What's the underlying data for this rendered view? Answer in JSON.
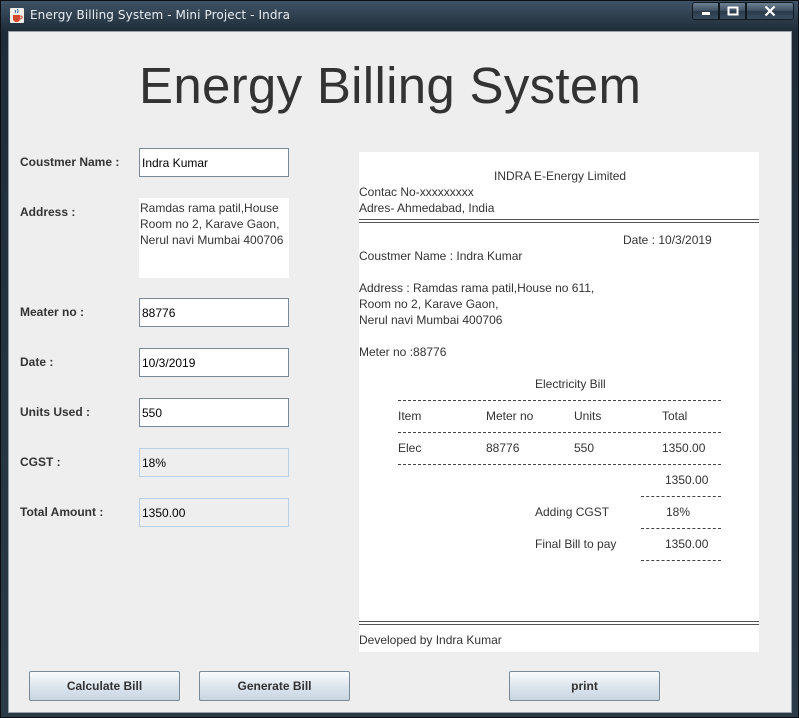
{
  "window": {
    "title": "Energy Billing System - Mini Project - Indra"
  },
  "heading": "Energy Billing System",
  "form": {
    "customer_name_label": "Coustmer Name :",
    "customer_name_value": "Indra Kumar",
    "address_label": "Address :",
    "address_lines": [
      "Ramdas rama patil,House",
      "Room no 2, Karave Gaon,",
      "Nerul navi Mumbai 400706"
    ],
    "meter_label": "Meater no :",
    "meter_value": "88776",
    "date_label": "Date :",
    "date_value": "10/3/2019",
    "units_label": "Units Used :",
    "units_value": "550",
    "cgst_label": "CGST :",
    "cgst_value": "18%",
    "total_label": "Total Amount :",
    "total_value": "1350.00"
  },
  "receipt": {
    "company": "INDRA   E-Energy   Limited",
    "contact": "Contac No-xxxxxxxxx",
    "address": "Adres- Ahmedabad, India",
    "date_line": "Date : 10/3/2019",
    "customer_line": "Coustmer Name : Indra Kumar",
    "address_lines": [
      "Address : Ramdas rama patil,House no 611,",
      "Room no 2, Karave Gaon,",
      "Nerul navi Mumbai 400706"
    ],
    "meter_line": "Meter no :88776",
    "bill_title": "Electricity Bill",
    "table_headers": [
      "Item",
      "Meter no",
      "Units",
      "Total"
    ],
    "table_row": [
      "Elec",
      "88776",
      "550",
      "1350.00"
    ],
    "subtotal": "1350.00",
    "cgst_label": "Adding CGST",
    "cgst_value": "18%",
    "final_label": "Final Bill to pay",
    "final_value": "1350.00",
    "footer": "Developed by Indra Kumar"
  },
  "buttons": {
    "calculate": "Calculate Bill",
    "generate": "Generate Bill",
    "print": "print"
  },
  "colors": {
    "background": "#eeeeee",
    "title_text": "#333333",
    "field_border": "#7a8a99",
    "readonly_border": "#b8cfe5"
  },
  "icons": {
    "app": "java-cup-icon",
    "minimize": "minimize-icon",
    "maximize": "maximize-icon",
    "close": "close-icon"
  }
}
